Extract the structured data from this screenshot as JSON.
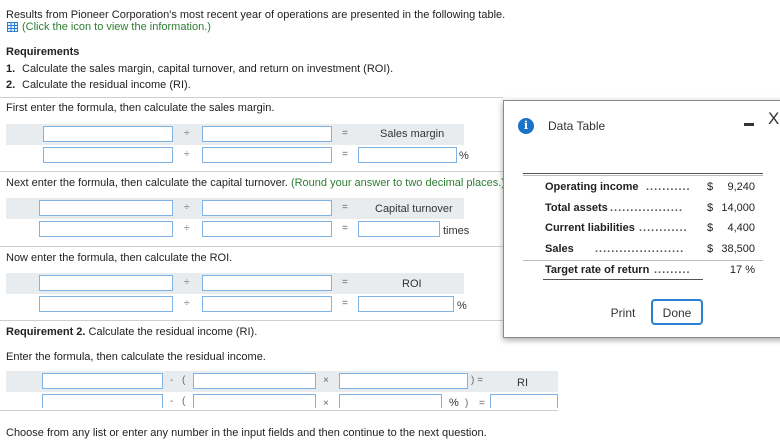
{
  "intro": {
    "text": "Results from Pioneer Corporation's most recent year of operations are presented in the following table.",
    "link": "(Click the icon to view the information.)"
  },
  "requirements": {
    "heading": "Requirements",
    "items": [
      {
        "num": "1.",
        "text": "Calculate the sales margin, capital turnover, and return on investment (ROI)."
      },
      {
        "num": "2.",
        "text": "Calculate the residual income (RI)."
      }
    ]
  },
  "section1": {
    "prompt": "First enter the formula, then calculate the sales margin.",
    "result_label": "Sales margin",
    "unit": "%"
  },
  "section2": {
    "prompt": "Next enter the formula, then calculate the capital turnover.",
    "note": "(Round your answer to two decimal places.)",
    "result_label": "Capital turnover",
    "unit": "times"
  },
  "section3": {
    "prompt": "Now enter the formula, then calculate the ROI.",
    "result_label": "ROI",
    "unit": "%"
  },
  "req2": {
    "heading": "Requirement 2.",
    "heading_rest": " Calculate the residual income (RI).",
    "prompt": "Enter the formula, then calculate the residual income.",
    "result_label": "RI",
    "unit": "%"
  },
  "operators": {
    "divide": "÷",
    "equals": "=",
    "minus": "-",
    "open_paren": "(",
    "times": "×",
    "close_eq": ") =",
    "close_paren": ")",
    "eq": "="
  },
  "footer": "Choose from any list or enter any number in the input fields and then continue to the next question.",
  "popup": {
    "title": "Data Table",
    "minimize_label": "−",
    "close_label": "X",
    "rows": [
      {
        "label": "Operating income",
        "dots": "...........",
        "currency": "$",
        "value": "9,240"
      },
      {
        "label": "Total assets",
        "dots": "..................",
        "currency": "$",
        "value": "14,000"
      },
      {
        "label": "Current liabilities",
        "dots": "............",
        "currency": "$",
        "value": "4,400"
      },
      {
        "label": "Sales",
        "dots": "......................",
        "currency": "$",
        "value": "38,500"
      },
      {
        "label": "Target rate of return",
        "dots": ".........",
        "currency": "",
        "value": "17 %"
      }
    ],
    "print_label": "Print",
    "done_label": "Done"
  },
  "colors": {
    "link_green": "#2e7d32",
    "input_border": "#7fb2e5",
    "band": "#e9ecef",
    "info_blue": "#1a73c8",
    "done_border": "#2a7fd4"
  }
}
